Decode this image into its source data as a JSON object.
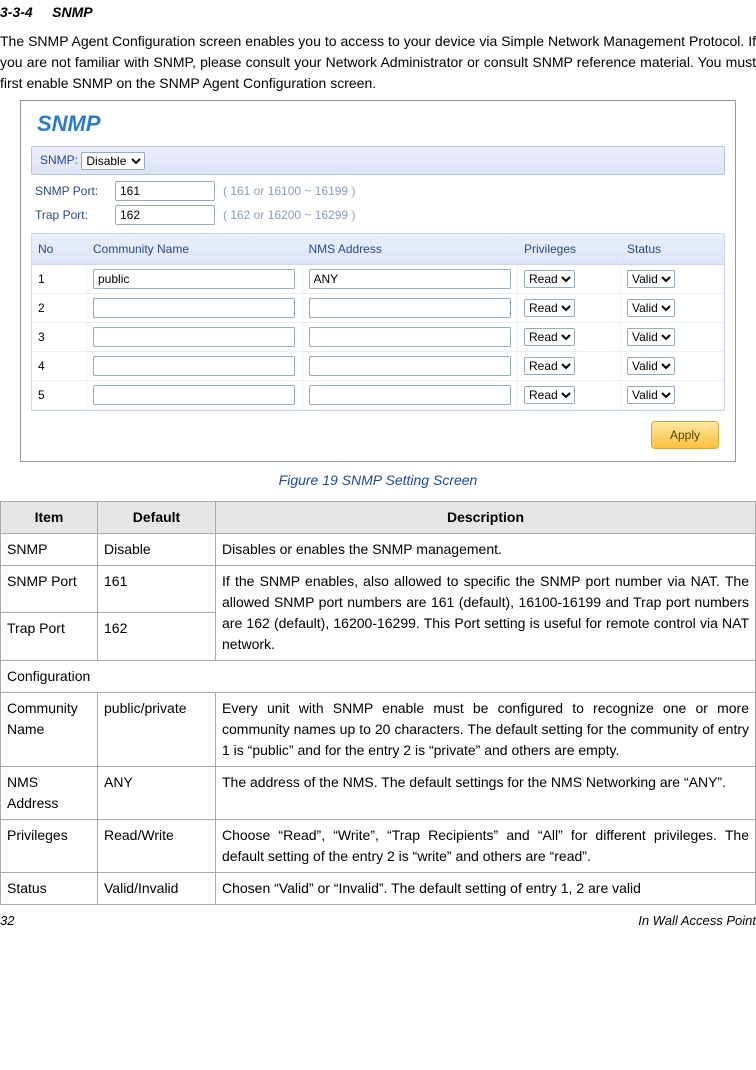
{
  "section": {
    "num": "3-3-4",
    "title": "SNMP"
  },
  "intro": "The SNMP Agent Configuration screen enables you to access to your device via Simple Network Management Protocol. If you are not familiar with SNMP, please consult your Network Administrator or consult SNMP reference material. You must first enable SNMP on the SNMP Agent Configuration screen.",
  "screen": {
    "title": "SNMP",
    "bar_label": "SNMP:",
    "bar_value": "Disable",
    "ports": {
      "snmp": {
        "label": "SNMP Port:",
        "value": "161",
        "hint": "( 161 or 16100 ~ 16199 )"
      },
      "trap": {
        "label": "Trap Port:",
        "value": "162",
        "hint": "( 162 or 16200 ~ 16299 )"
      }
    },
    "headers": {
      "no": "No",
      "community": "Community Name",
      "nms": "NMS Address",
      "priv": "Privileges",
      "status": "Status"
    },
    "rows": [
      {
        "no": "1",
        "community": "public",
        "nms": "ANY",
        "priv": "Read",
        "status": "Valid"
      },
      {
        "no": "2",
        "community": "",
        "nms": "",
        "priv": "Read",
        "status": "Valid"
      },
      {
        "no": "3",
        "community": "",
        "nms": "",
        "priv": "Read",
        "status": "Valid"
      },
      {
        "no": "4",
        "community": "",
        "nms": "",
        "priv": "Read",
        "status": "Valid"
      },
      {
        "no": "5",
        "community": "",
        "nms": "",
        "priv": "Read",
        "status": "Valid"
      }
    ],
    "apply": "Apply"
  },
  "fig_caption": "Figure 19 SNMP Setting Screen",
  "tbl": {
    "head": {
      "item": "Item",
      "def": "Default",
      "desc": "Description"
    },
    "rows": {
      "snmp": {
        "item": "SNMP",
        "def": "Disable",
        "desc": "Disables or enables the SNMP management."
      },
      "snmpport": {
        "item": "SNMP Port",
        "def": "161"
      },
      "trapport": {
        "item": "Trap Port",
        "def": "162",
        "desc": "If the SNMP enables, also allowed to specific the SNMP port number via NAT. The allowed SNMP port numbers are 161 (default), 16100-16199 and Trap port numbers are 162 (default), 16200-16299. This Port setting is useful for remote control via NAT network."
      },
      "config": "Configuration",
      "community": {
        "item": "Community Name",
        "def": "public/private",
        "desc": "Every unit with SNMP enable must be configured to recognize one or more community names up to 20 characters. The default setting for the community of entry 1 is “public” and for the entry 2 is “private” and others are empty."
      },
      "nms": {
        "item": "NMS Address",
        "def": "ANY",
        "desc": "The address of the NMS. The default settings for the NMS Networking are “ANY”."
      },
      "priv": {
        "item": "Privileges",
        "def": "Read/Write",
        "desc": "Choose “Read”, “Write”, “Trap Recipients” and “All” for different privileges. The default setting of the entry 2 is “write” and others are “read”."
      },
      "status": {
        "item": "Status",
        "def": "Valid/Invalid",
        "desc": "Chosen “Valid” or “Invalid”. The default setting of entry 1, 2 are valid"
      }
    }
  },
  "footer": {
    "page": "32",
    "title": "In Wall Access Point"
  }
}
